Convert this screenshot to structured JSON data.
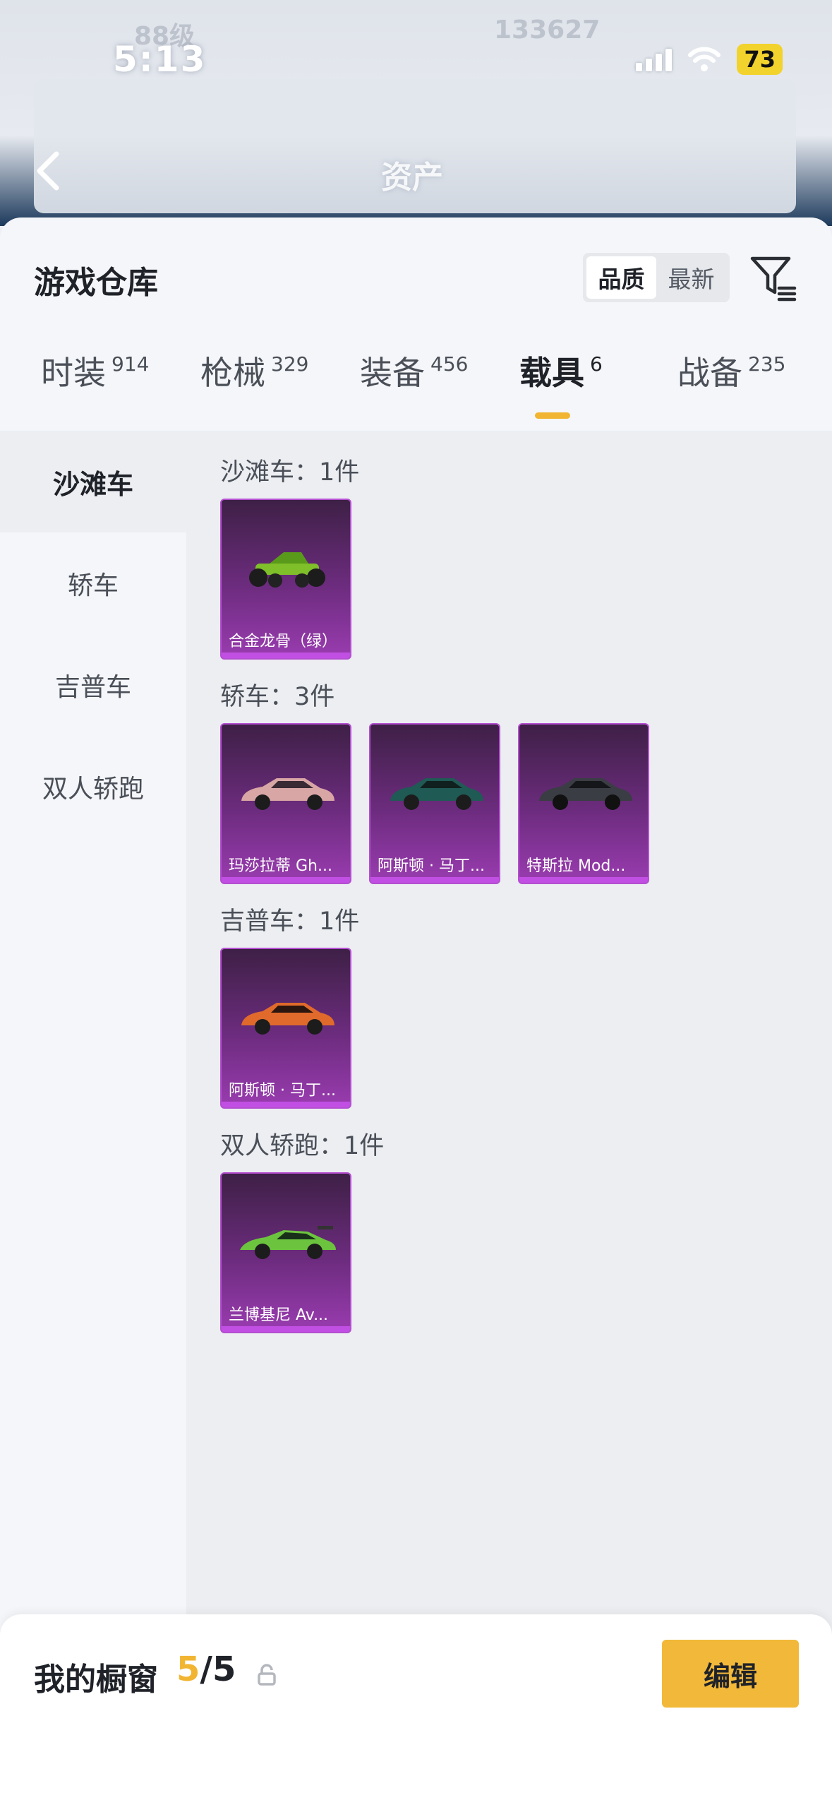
{
  "status_bar": {
    "time": "5:13",
    "battery": "73"
  },
  "header_bg": {
    "title": "资产",
    "blur_left": "88级",
    "blur_right": "133627"
  },
  "warehouse": {
    "title": "游戏仓库",
    "sort": [
      "品质",
      "最新"
    ],
    "sort_selected": "品质"
  },
  "tabs": [
    {
      "label": "时装",
      "count": "914"
    },
    {
      "label": "枪械",
      "count": "329"
    },
    {
      "label": "装备",
      "count": "456"
    },
    {
      "label": "载具",
      "count": "6"
    },
    {
      "label": "战备",
      "count": "235"
    }
  ],
  "active_tab": "载具",
  "side_menu": [
    "沙滩车",
    "轿车",
    "吉普车",
    "双人轿跑"
  ],
  "active_side": "沙滩车",
  "groups": [
    {
      "header": "沙滩车：1件",
      "items": [
        {
          "name": "合金龙骨（绿）",
          "car_color": "#7fbf2a"
        }
      ]
    },
    {
      "header": "轿车：3件",
      "items": [
        {
          "name": "玛莎拉蒂 Gh...",
          "car_color": "#d9a6a6"
        },
        {
          "name": "阿斯顿 · 马丁...",
          "car_color": "#1f5a55"
        },
        {
          "name": "特斯拉 Mod...",
          "car_color": "#3a3d44"
        }
      ]
    },
    {
      "header": "吉普车：1件",
      "items": [
        {
          "name": "阿斯顿 · 马丁...",
          "car_color": "#e06a2c"
        }
      ]
    },
    {
      "header": "双人轿跑：1件",
      "items": [
        {
          "name": "兰博基尼 Av...",
          "car_color": "#6cc43e"
        }
      ]
    }
  ],
  "showcase": {
    "label": "我的橱窗",
    "current": "5",
    "total": "/5",
    "edit_label": "编辑"
  },
  "colors": {
    "accent": "#f2b83a",
    "card_purple": "#6d2c7f"
  }
}
